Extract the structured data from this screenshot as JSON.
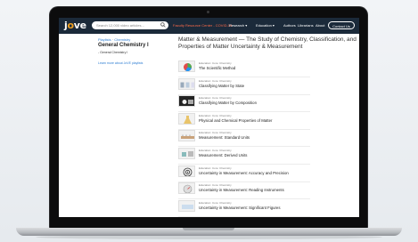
{
  "header": {
    "logo": "jove",
    "search_placeholder": "Search 12,000 video articles...",
    "covid_label": "Faculty Resource Center - COVID-19",
    "nav": [
      "Research ▾",
      "Education ▾",
      "Authors",
      "Librarians",
      "About"
    ],
    "contact_label": "Contact Us"
  },
  "sidebar": {
    "breadcrumb": [
      "Playlists",
      "Chemistry"
    ],
    "playlist_title": "General Chemistry I",
    "playlist_item": "- General Chemistry I",
    "learn_more": "Learn more about JoVE playlists"
  },
  "main": {
    "title": "Matter & Measurement — The Study of Chemistry, Classification, and Properties of Matter Uncertainty & Measurement",
    "videos": [
      {
        "category": "Education: Core: Chemistry",
        "title": "The Scientific Method",
        "thumb": "pie"
      },
      {
        "category": "Education: Core: Chemistry",
        "title": "Classifying Matter by State",
        "thumb": "states"
      },
      {
        "category": "Education: Core: Chemistry",
        "title": "Classifying Matter by Composition",
        "thumb": "dark"
      },
      {
        "category": "Education: Core: Chemistry",
        "title": "Physical and Chemical Properties of Matter",
        "thumb": "flask"
      },
      {
        "category": "Education: Core: Chemistry",
        "title": "Measurement: Standard Units",
        "thumb": "units"
      },
      {
        "category": "Education: Core: Chemistry",
        "title": "Measurement: Derived Units",
        "thumb": "boxes"
      },
      {
        "category": "Education: Core: Chemistry",
        "title": "Uncertainty in Measurement: Accuracy and Precision",
        "thumb": "target"
      },
      {
        "category": "Education: Core: Chemistry",
        "title": "Uncertainty in Measurement: Reading Instruments",
        "thumb": "dial"
      },
      {
        "category": "Education: Core: Chemistry",
        "title": "Uncertainty in Measurement: Significant Figures",
        "thumb": "figures"
      }
    ]
  },
  "colors": {
    "header_bg": "#1b2a3a",
    "accent_orange": "#f0a020",
    "covid_red": "#ff6b4a",
    "link_blue": "#2a7bd1"
  }
}
